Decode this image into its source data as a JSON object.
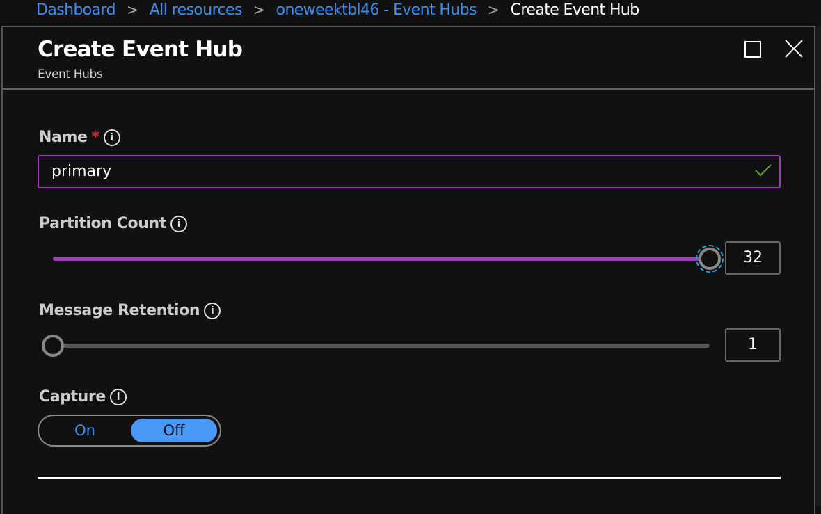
{
  "breadcrumb": {
    "items": [
      "Dashboard",
      "All resources",
      "oneweektbl46 - Event Hubs"
    ],
    "current": "Create Event Hub",
    "separator": ">"
  },
  "panel": {
    "title": "Create Event Hub",
    "subtitle": "Event Hubs",
    "icons": [
      "maximize-icon",
      "close-icon"
    ]
  },
  "form": {
    "name": {
      "label": "Name",
      "required_mark": "*",
      "value": "primary",
      "valid": true
    },
    "partition_count": {
      "label": "Partition Count",
      "value": "32",
      "min": 1,
      "max": 32
    },
    "message_retention": {
      "label": "Message Retention",
      "value": "1",
      "min": 1,
      "max": 7
    },
    "capture": {
      "label": "Capture",
      "on_label": "On",
      "off_label": "Off",
      "selected": "Off"
    },
    "info_glyph": "i"
  },
  "colors": {
    "accent": "#9c3fb5",
    "link": "#3e8ee8",
    "toggle_selected": "#4a98f5",
    "focus": "#1ea4e0",
    "valid": "#5ba12c",
    "required": "#e02020"
  }
}
